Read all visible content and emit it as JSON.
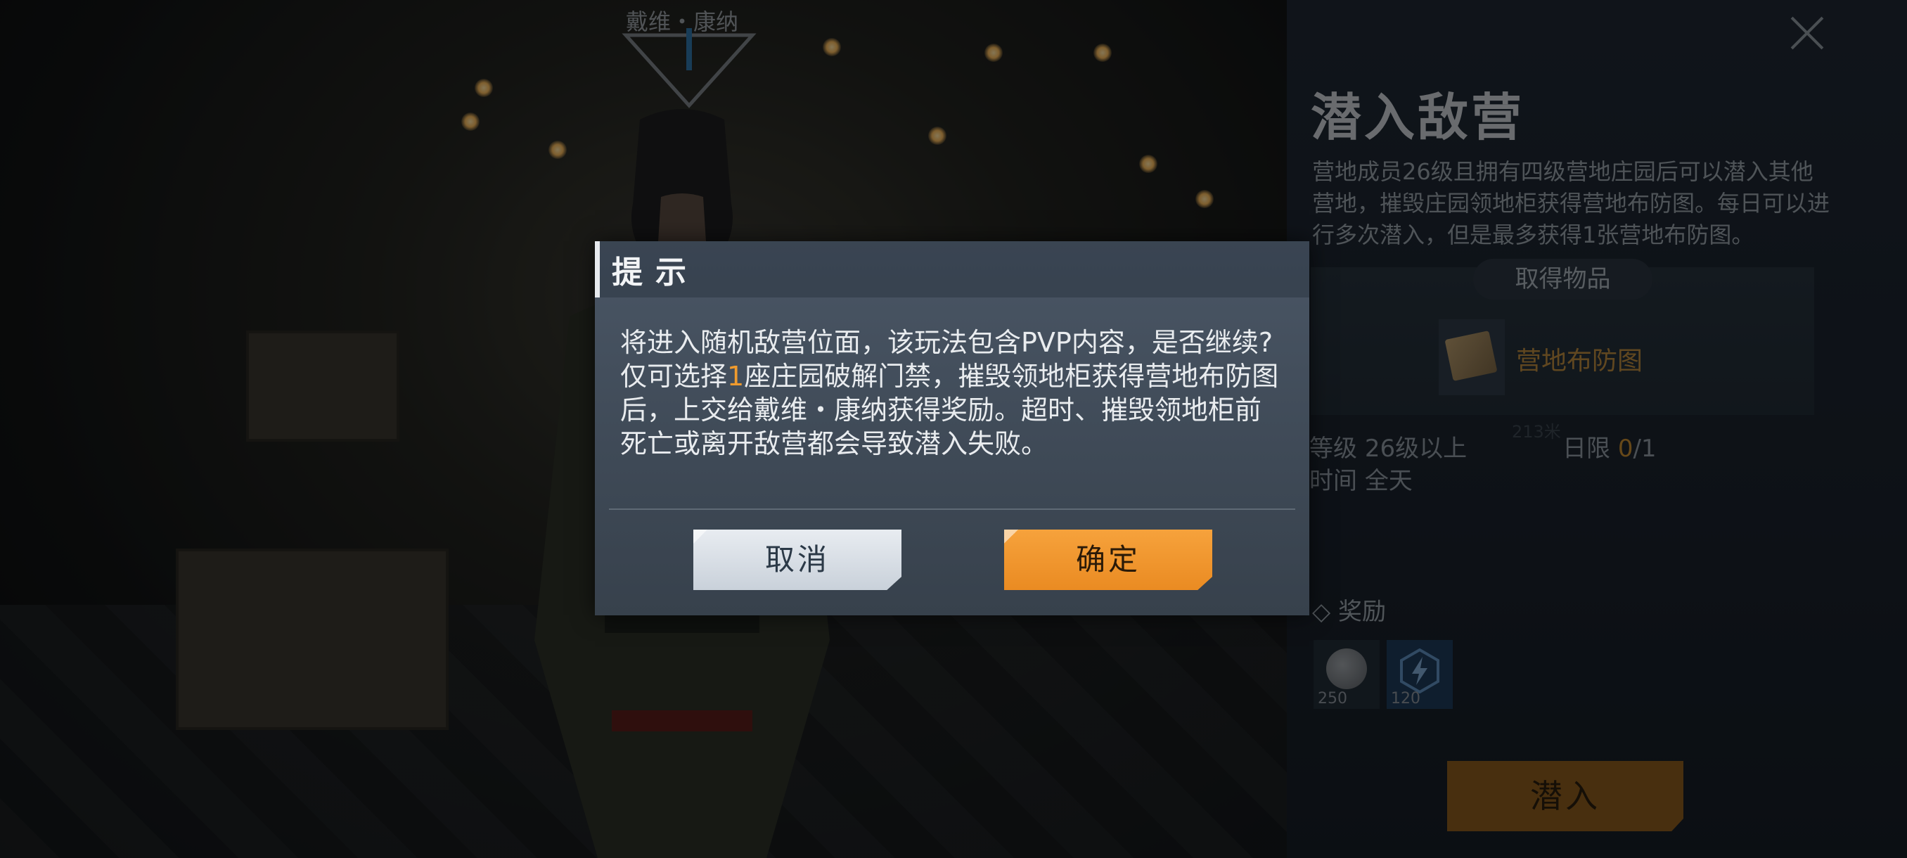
{
  "scene": {
    "npc_name": "戴维・康纳"
  },
  "panel": {
    "title": "潜入敌营",
    "description": "营地成员26级且拥有四级营地庄园后可以潜入其他营地，摧毁庄园领地柜获得营地布防图。每日可以进行多次潜入，但是最多获得1张营地布防图。",
    "items_title": "取得物品",
    "item_name": "营地布防图",
    "faint_text": "213米",
    "level_label": "等级",
    "level_value": "26级以上",
    "time_label": "时间",
    "time_value": "全天",
    "daily_label": "日限",
    "daily_current": "0",
    "daily_max": "/1",
    "reward_heading": "◇ 奖励",
    "rewards": [
      {
        "icon": "coin-icon",
        "count": "250"
      },
      {
        "icon": "lightning-icon",
        "count": "120"
      }
    ],
    "enter_label": "潜入"
  },
  "dialog": {
    "title": "提示",
    "line1": "将进入随机敌营位面，该玩法包含PVP内容，是否继续?",
    "line2_a": "仅可选择",
    "line2_num": "1",
    "line2_b": "座庄园破解门禁，摧毁领地柜获得营地布防图",
    "line3": "后，上交给戴维・康纳获得奖励。超时、摧毁领地柜前",
    "line4": "死亡或离开敌营都会导致潜入失败。",
    "cancel_label": "取消",
    "confirm_label": "确定"
  },
  "colors": {
    "accent_orange": "#ea8b22",
    "highlight_number": "#f09b2e",
    "dialog_bg": "#3f4a57"
  }
}
